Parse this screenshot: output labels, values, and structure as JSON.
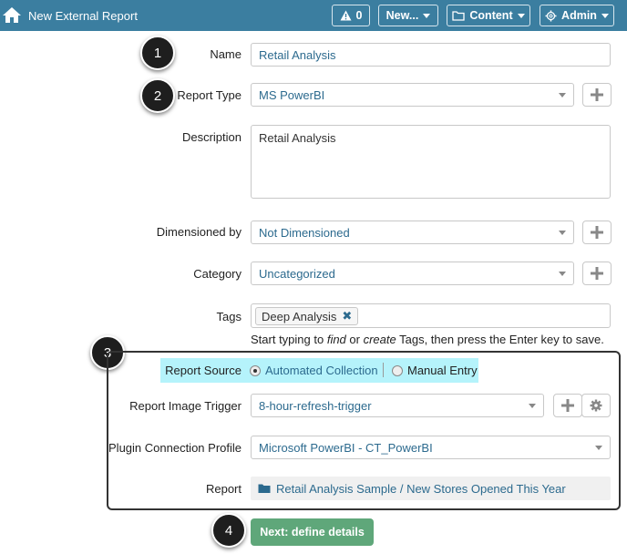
{
  "header": {
    "title": "New External Report",
    "alerts_label": "0",
    "new_label": "New...",
    "content_label": "Content",
    "admin_label": "Admin"
  },
  "callouts": [
    "1",
    "2",
    "3",
    "4"
  ],
  "form": {
    "name": {
      "label": "Name",
      "value": "Retail Analysis"
    },
    "report_type": {
      "label": "Report Type",
      "value": "MS PowerBI"
    },
    "description": {
      "label": "Description",
      "value": "Retail Analysis"
    },
    "dimensioned_by": {
      "label": "Dimensioned by",
      "value": "Not Dimensioned"
    },
    "category": {
      "label": "Category",
      "value": "Uncategorized"
    },
    "tags": {
      "label": "Tags",
      "items": [
        "Deep Analysis"
      ],
      "hint_pre": "Start typing to ",
      "hint_find": "find",
      "hint_mid": " or ",
      "hint_create": "create",
      "hint_post": " Tags, then press the Enter key to save."
    },
    "report_source": {
      "label": "Report Source",
      "options": [
        "Automated Collection",
        "Manual Entry"
      ],
      "selected": "Automated Collection"
    },
    "report_image_trigger": {
      "label": "Report Image Trigger",
      "value": "8-hour-refresh-trigger"
    },
    "plugin_connection_profile": {
      "label": "Plugin Connection Profile",
      "value": "Microsoft PowerBI - CT_PowerBI"
    },
    "report": {
      "label": "Report",
      "value": "Retail Analysis Sample / New Stores Opened This Year"
    }
  },
  "next_button": "Next: define details",
  "colors": {
    "header_bg": "#3b7ea0",
    "link_blue": "#2c6a8e",
    "highlight": "#b5f3fb",
    "next_button": "#5fa77a"
  }
}
